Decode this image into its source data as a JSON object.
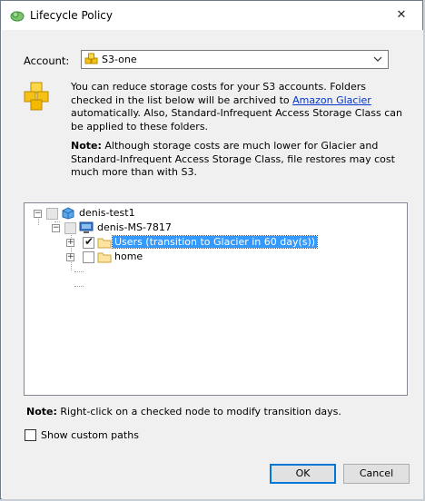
{
  "window": {
    "title": "Lifecycle Policy",
    "close_glyph": "✕"
  },
  "account": {
    "label": "Account:",
    "selected": "S3-one",
    "icon": "s3-cubes-icon"
  },
  "info": {
    "text_before_link": "You can reduce storage costs for your S3 accounts. Folders checked in the list below will be archived to ",
    "link_text": "Amazon Glacier",
    "text_after_link": " automatically. Also, Standard-Infrequent Access Storage Class can be applied to these folders.",
    "note_label": "Note:",
    "note_text": "  Although storage costs are much lower for Glacier and Standard-Infrequent Access Storage Class, file restores may cost much more than with S3."
  },
  "tree": {
    "root": {
      "label": "denis-test1",
      "expander": "−",
      "checked": false
    },
    "computer": {
      "label": "denis-MS-7817",
      "expander": "−",
      "checked": false
    },
    "folders": [
      {
        "label": "Users (transition to Glacier in 60 day(s))",
        "expander": "+",
        "checked": true,
        "selected": true
      },
      {
        "label": "home",
        "expander": "+",
        "checked": false,
        "selected": false
      }
    ]
  },
  "footer": {
    "note_label": "Note:",
    "note_text": "  Right-click on a checked node to modify transition days.",
    "custom_paths_label": "Show custom paths",
    "custom_paths_checked": false,
    "ok_label": "OK",
    "cancel_label": "Cancel"
  },
  "colors": {
    "selection": "#3399ff",
    "link": "#0033cc",
    "ok_border": "#0078d7",
    "cube_yellow": "#f5c116"
  }
}
